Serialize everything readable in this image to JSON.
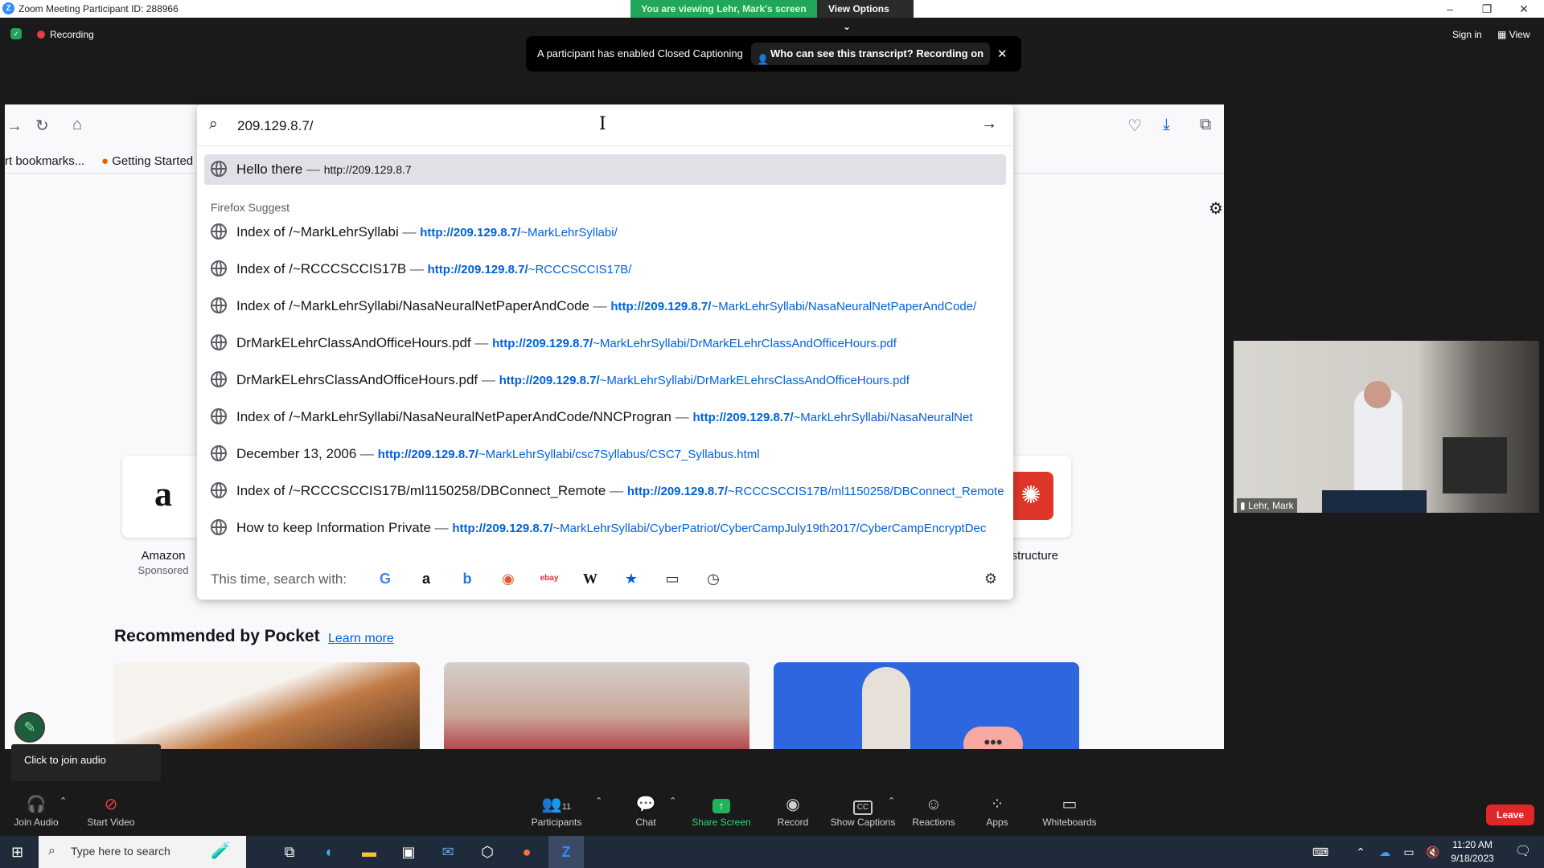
{
  "zoom_window": {
    "title": "Zoom Meeting Participant ID: 288966",
    "viewing_banner": "You are viewing Lehr, Mark's screen",
    "view_options": "View Options",
    "recording": "Recording",
    "sign_in": "Sign in",
    "view": "View",
    "cc_banner": {
      "message": "A participant has enabled Closed Captioning",
      "who_button": "Who can see this transcript? Recording on"
    }
  },
  "browser": {
    "bookmarks": {
      "import": "rt bookmarks...",
      "getting_started": "Getting Started"
    },
    "urlbar": {
      "value": "209.129.8.7/",
      "heuristic": {
        "title": "Hello there",
        "url": "http://209.129.8.7"
      },
      "suggest_header": "Firefox Suggest",
      "suggestions": [
        {
          "title": "Index of /~MarkLehrSyllabi",
          "host": "http://209.129.8.7/",
          "path": "~MarkLehrSyllabi/"
        },
        {
          "title": "Index of /~RCCCSCCIS17B",
          "host": "http://209.129.8.7/",
          "path": "~RCCCSCCIS17B/"
        },
        {
          "title": "Index of /~MarkLehrSyllabi/NasaNeuralNetPaperAndCode",
          "host": "http://209.129.8.7/",
          "path": "~MarkLehrSyllabi/NasaNeuralNetPaperAndCode/"
        },
        {
          "title": "DrMarkELehrClassAndOfficeHours.pdf",
          "host": "http://209.129.8.7/",
          "path": "~MarkLehrSyllabi/DrMarkELehrClassAndOfficeHours.pdf"
        },
        {
          "title": "DrMarkELehrsClassAndOfficeHours.pdf",
          "host": "http://209.129.8.7/",
          "path": "~MarkLehrSyllabi/DrMarkELehrsClassAndOfficeHours.pdf"
        },
        {
          "title": "Index of /~MarkLehrSyllabi/NasaNeuralNetPaperAndCode/NNCProgran",
          "host": "http://209.129.8.7/",
          "path": "~MarkLehrSyllabi/NasaNeuralNet"
        },
        {
          "title": "December 13, 2006",
          "host": "http://209.129.8.7/",
          "path": "~MarkLehrSyllabi/csc7Syllabus/CSC7_Syllabus.html"
        },
        {
          "title": "Index of /~RCCCSCCIS17B/ml1150258/DBConnect_Remote",
          "host": "http://209.129.8.7/",
          "path": "~RCCCSCCIS17B/ml1150258/DBConnect_Remote"
        },
        {
          "title": "How to keep Information Private",
          "host": "http://209.129.8.7/",
          "path": "~MarkLehrSyllabi/CyberPatriot/CyberCampJuly19th2017/CyberCampEncryptDec"
        }
      ],
      "search_with_label": "This time, search with:",
      "engines": [
        "google-icon",
        "amazon-icon",
        "bing-icon",
        "duckduckgo-icon",
        "ebay-icon",
        "wikipedia-icon",
        "bookmarks-icon",
        "tabs-icon",
        "history-icon"
      ]
    },
    "tiles": [
      {
        "name": "Amazon",
        "sub": "Sponsored"
      },
      {
        "name": "instructure",
        "sub": ""
      }
    ],
    "pocket": {
      "title": "Recommended by Pocket",
      "learn_more": "Learn more"
    }
  },
  "participant": {
    "name": "Lehr, Mark"
  },
  "join_audio_tip": "Click to join audio",
  "toolbar": {
    "join_audio": "Join Audio",
    "start_video": "Start Video",
    "participants": "Participants",
    "participant_count": "11",
    "chat": "Chat",
    "share_screen": "Share Screen",
    "record": "Record",
    "show_captions": "Show Captions",
    "reactions": "Reactions",
    "apps": "Apps",
    "whiteboards": "Whiteboards",
    "leave": "Leave"
  },
  "taskbar": {
    "search_placeholder": "Type here to search",
    "time": "11:20 AM",
    "date": "9/18/2023"
  },
  "colors": {
    "accent_green": "#21a65b",
    "zoom_blue": "#2d8cff",
    "leave_red": "#e02828",
    "link_blue": "#0061e0"
  }
}
